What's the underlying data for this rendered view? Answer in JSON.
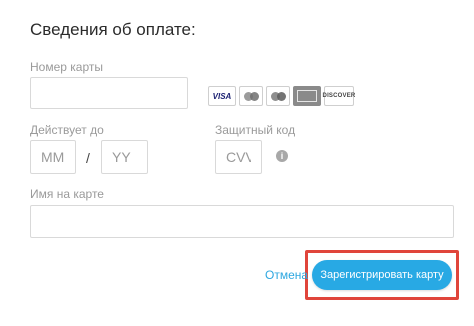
{
  "form": {
    "title": "Сведения об оплате:",
    "card_number": {
      "label": "Номер карты",
      "value": ""
    },
    "valid_until": {
      "label": "Действует до",
      "month_placeholder": "MM",
      "separator": "/",
      "year_placeholder": "YY"
    },
    "security_code": {
      "label": "Защитный код",
      "placeholder": "CVV",
      "info_icon": "info-icon"
    },
    "name_on_card": {
      "label": "Имя на карте",
      "value": ""
    },
    "card_brands": [
      {
        "name": "visa",
        "text": "VISA"
      },
      {
        "name": "mastercard",
        "text": ""
      },
      {
        "name": "maestro",
        "text": ""
      },
      {
        "name": "american-express",
        "text": ""
      },
      {
        "name": "discover",
        "text": "DISCOVER"
      }
    ]
  },
  "actions": {
    "cancel_label": "Отмена",
    "register_label": "Зарегистрировать карту",
    "highlight_color": "#e0453b",
    "primary_color": "#28a9e4"
  }
}
